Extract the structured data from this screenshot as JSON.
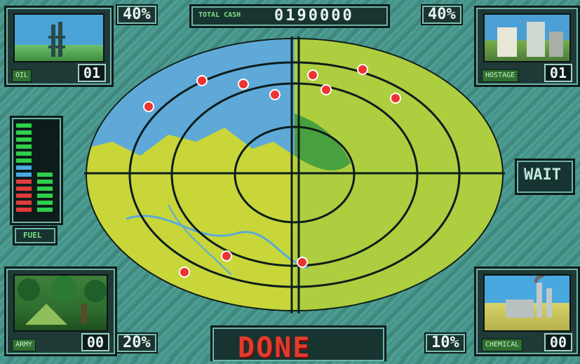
{
  "hud": {
    "total_cash_label": "TOTAL CASH",
    "total_cash_value": "0190000",
    "top_left_percent": "40%",
    "top_right_percent": "40%",
    "bottom_left_percent": "20%",
    "bottom_right_percent": "10%",
    "wait_button": "WAIT",
    "done_button": "DONE",
    "fuel_label": "FUEL"
  },
  "panels": {
    "top_left": {
      "label": "OIL",
      "count": "01"
    },
    "top_right": {
      "label": "HOSTAGE",
      "count": "01"
    },
    "bottom_left": {
      "label": "ARMY",
      "count": "00"
    },
    "bottom_right": {
      "label": "CHEMICAL",
      "count": "00"
    }
  },
  "fuel": {
    "green_level": 0.6,
    "red_level": 0.4
  },
  "colors": {
    "map_land": "#c8d63a",
    "map_sea": "#5ea9d8",
    "target": "#e33333",
    "done_text": "#e23b2b"
  }
}
